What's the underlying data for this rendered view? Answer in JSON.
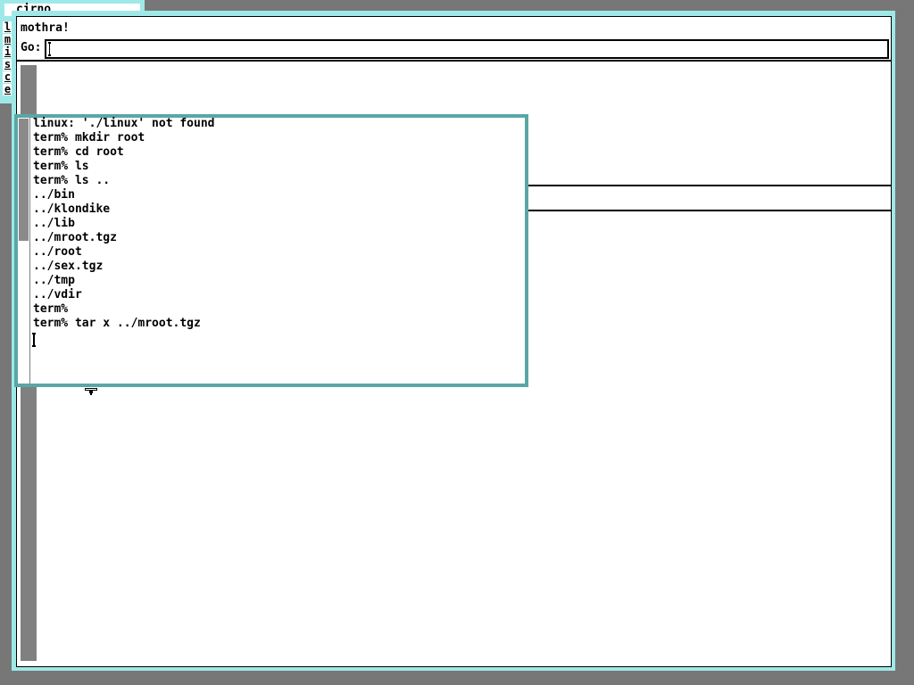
{
  "back_window": {
    "title": "cirno"
  },
  "side_tabs": [
    "l",
    "m",
    "i",
    "s",
    "c",
    "e"
  ],
  "browser": {
    "title": "mothra!",
    "go_label": "Go:",
    "go_value": ""
  },
  "terminal": {
    "lines": [
      "linux: './linux' not found",
      "term% mkdir root",
      "term% cd root",
      "term% ls",
      "term% ls ..",
      "../bin",
      "../klondike",
      "../lib",
      "../mroot.tgz",
      "../root",
      "../sex.tgz",
      "../tmp",
      "../vdir",
      "term%",
      "term% tar x ../mroot.tgz"
    ]
  },
  "colors": {
    "desktop": "#777777",
    "window_border": "#9fe8e8",
    "active_border": "#5aa6a6",
    "scrollbar": "#808080"
  },
  "icons": {
    "text_cursor": "text-cursor-icon",
    "mouse_pointer": "mouse-pointer-icon"
  }
}
